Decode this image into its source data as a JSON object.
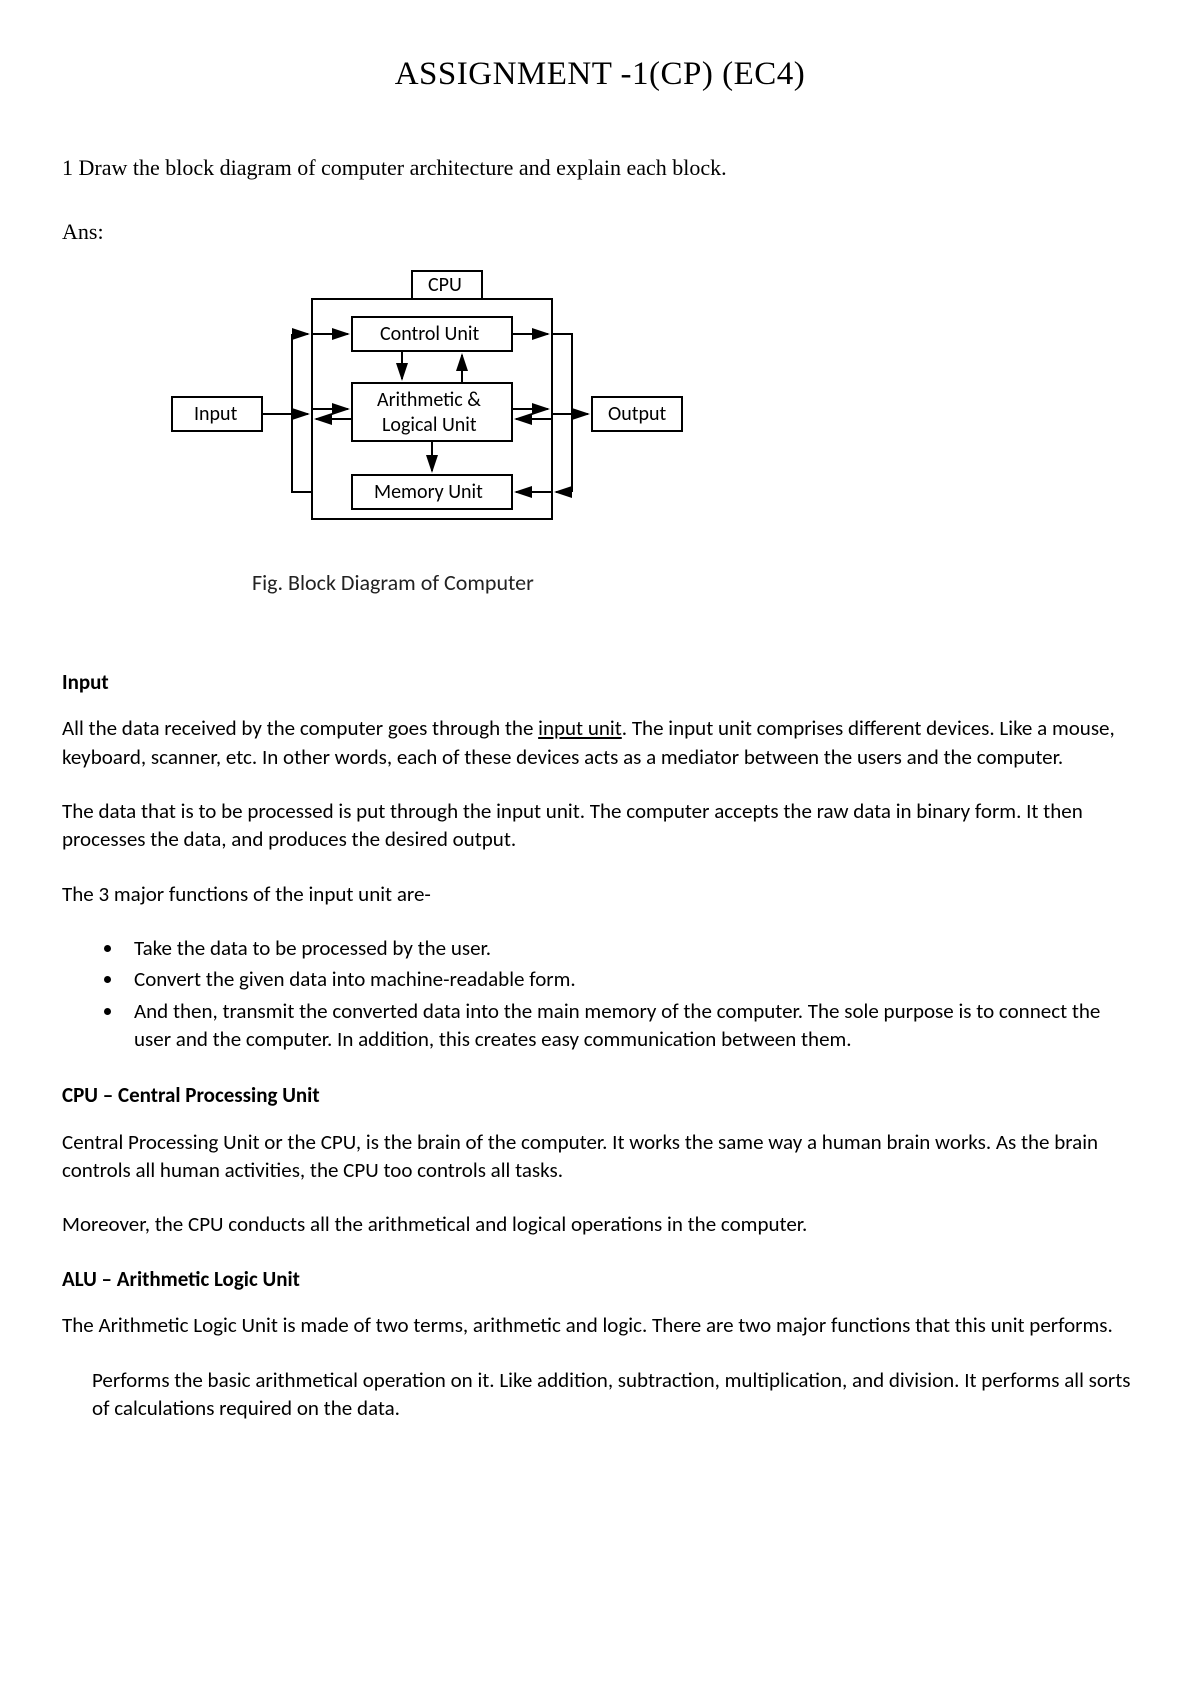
{
  "title": "ASSIGNMENT -1(CP) (EC4)",
  "question": "1 Draw the block diagram of computer architecture and explain each block.",
  "ans": "Ans:",
  "diagram": {
    "cpu": "CPU",
    "control": "Control Unit",
    "alu1": "Arithmetic &",
    "alu2": "Logical Unit",
    "memory": "Memory Unit",
    "input": "Input",
    "output": "Output",
    "caption": "Fig. Block Diagram of Computer"
  },
  "sections": {
    "input": {
      "heading": "Input",
      "p1a": "All the data received by the computer goes through the ",
      "p1link": "input unit",
      "p1b": ". The input unit comprises different devices. Like a mouse, keyboard, scanner, etc. In other words, each of these devices acts as a mediator between the users and the computer.",
      "p2": "The data that is to be processed is put through the input unit. The computer accepts the raw data in binary form. It then processes the data, and produces the desired output.",
      "p3": "The 3 major functions of the input unit are-",
      "b1": "Take the data to be processed by the user.",
      "b2": "Convert the given data into machine-readable form.",
      "b3": "And then, transmit the converted data into the main memory of the computer. The sole purpose is to connect the user and the computer. In addition, this creates easy communication between them."
    },
    "cpu": {
      "heading": "CPU – Central Processing Unit",
      "p1": "Central Processing Unit or the CPU, is the brain of the computer. It works the same way a human brain works. As the brain controls all human activities, the CPU too controls all tasks.",
      "p2": "Moreover, the CPU conducts all the arithmetical and logical operations in the computer."
    },
    "alu": {
      "heading": "ALU – Arithmetic Logic Unit",
      "p1": "The Arithmetic Logic Unit is made of two terms, arithmetic and logic. There are two major functions that this unit performs.",
      "p2": "Performs the basic arithmetical operation on it. Like addition, subtraction, multiplication, and division. It performs all sorts of calculations required on the data."
    }
  }
}
